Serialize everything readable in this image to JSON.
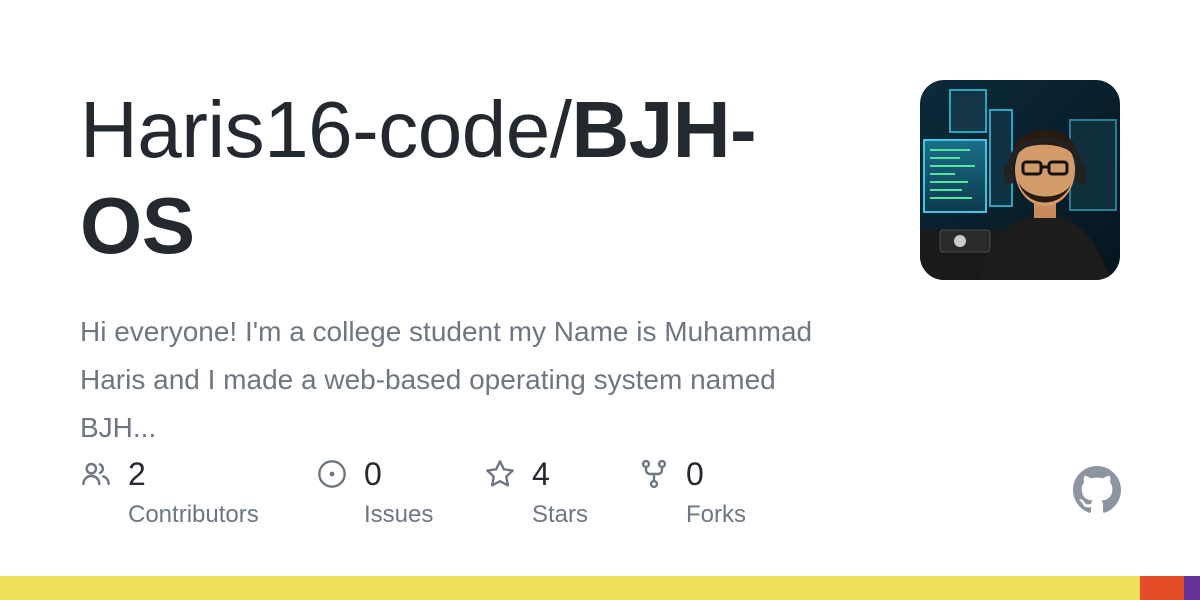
{
  "repo": {
    "owner": "Haris16-code/",
    "name": "BJH-OS",
    "description": "Hi everyone! I'm a college student my Name is Muhammad Haris and I made a web-based operating system named BJH..."
  },
  "stats": [
    {
      "icon": "people-icon",
      "count": "2",
      "label": "Contributors"
    },
    {
      "icon": "issue-icon",
      "count": "0",
      "label": "Issues"
    },
    {
      "icon": "star-icon",
      "count": "4",
      "label": "Stars"
    },
    {
      "icon": "fork-icon",
      "count": "0",
      "label": "Forks"
    }
  ],
  "languages": [
    {
      "color": "#f1e05a",
      "share": 0.95
    },
    {
      "color": "#e34c26",
      "share": 0.037
    },
    {
      "color": "#663399",
      "share": 0.013
    }
  ],
  "colors": {
    "title": "#24292f",
    "muted": "#6e7781",
    "github_logo": "#8c959f"
  }
}
